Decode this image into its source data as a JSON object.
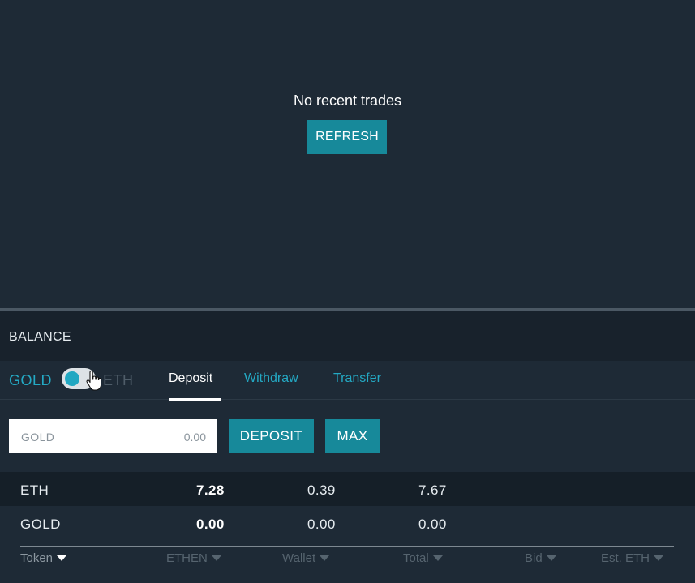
{
  "trades": {
    "empty_message": "No recent trades",
    "refresh_label": "REFRESH"
  },
  "balance": {
    "title": "BALANCE",
    "toggle": {
      "left_token": "GOLD",
      "right_token": "ETH",
      "active": "GOLD"
    },
    "tabs": [
      {
        "label": "Deposit",
        "active": true
      },
      {
        "label": "Withdraw",
        "active": false
      },
      {
        "label": "Transfer",
        "active": false
      }
    ],
    "form": {
      "token_label": "GOLD",
      "amount_placeholder": "0.00",
      "deposit_label": "DEPOSIT",
      "max_label": "MAX"
    },
    "table": {
      "rows": [
        {
          "token": "ETH",
          "ethen": "7.28",
          "wallet": "0.39",
          "total": "7.67"
        },
        {
          "token": "GOLD",
          "ethen": "0.00",
          "wallet": "0.00",
          "total": "0.00"
        }
      ],
      "columns": [
        "Token",
        "ETHEN",
        "Wallet",
        "Total",
        "Bid",
        "Est. ETH"
      ]
    }
  },
  "colors": {
    "background": "#1e2a36",
    "header_background": "#18222c",
    "accent": "#17899a",
    "link": "#24a9c4"
  }
}
